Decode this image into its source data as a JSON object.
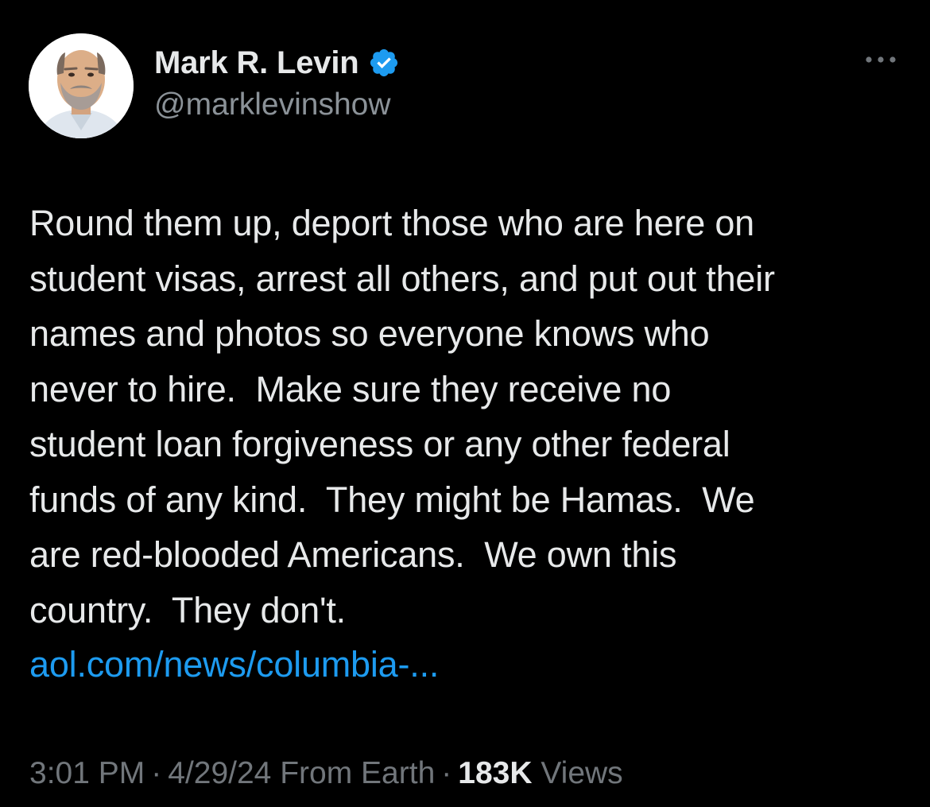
{
  "author": {
    "display_name": "Mark R. Levin",
    "handle": "@marklevinshow",
    "verified_color": "#1d9bf0",
    "avatar_alt": "profile-photo"
  },
  "menu": {
    "icon": "more-horizontal-icon"
  },
  "tweet": {
    "text": "Round them up, deport those who are here on\nstudent visas, arrest all others, and put out their\nnames and photos so everyone knows who\nnever to hire.  Make sure they receive no\nstudent loan forgiveness or any other federal\nfunds of any kind.  They might be Hamas.  We\nare red-blooded Americans.  We own this\ncountry.  They don't.",
    "link_text": "aol.com/news/columbia-...",
    "link_color": "#1d9bf0"
  },
  "meta": {
    "time": "3:01 PM",
    "separator": "·",
    "date": "4/29/24",
    "source": "From Earth",
    "views_count": "183K",
    "views_label": "Views"
  },
  "colors": {
    "background": "#000000",
    "text_primary": "#e7e9ea",
    "text_secondary": "#71767b",
    "accent": "#1d9bf0"
  }
}
